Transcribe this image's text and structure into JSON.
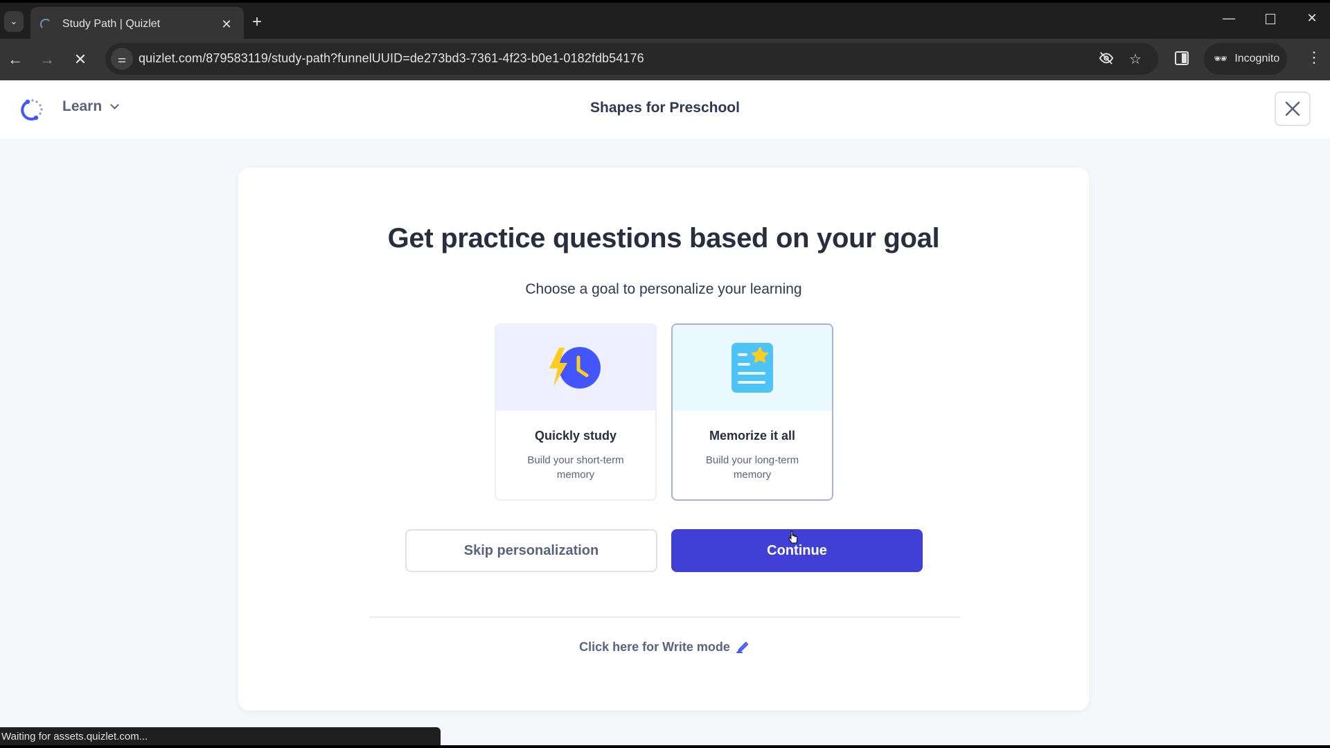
{
  "browser": {
    "tab_title": "Study Path | Quizlet",
    "url": "quizlet.com/879583119/study-path?funnelUUID=de273bd3-7361-4f23-b0e1-0182fdb54176",
    "incognito_label": "Incognito",
    "status_text": "Waiting for assets.quizlet.com..."
  },
  "header": {
    "mode_label": "Learn",
    "set_title": "Shapes for Preschool"
  },
  "main": {
    "heading": "Get practice questions based on your goal",
    "subheading": "Choose a goal to personalize your learning",
    "goals": [
      {
        "title": "Quickly study",
        "description": "Build your short-term memory",
        "icon": "lightning-clock-icon",
        "selected": false
      },
      {
        "title": "Memorize it all",
        "description": "Build your long-term memory",
        "icon": "document-star-icon",
        "selected": true
      }
    ],
    "skip_label": "Skip personalization",
    "continue_label": "Continue",
    "write_mode_label": "Click here for Write mode"
  },
  "colors": {
    "primary": "#4040d6",
    "text_dark": "#282e3e",
    "text_muted": "#586380",
    "clock_blue": "#4255ff",
    "bolt_yellow": "#ffcd1f",
    "doc_blue": "#4dc3f7"
  }
}
